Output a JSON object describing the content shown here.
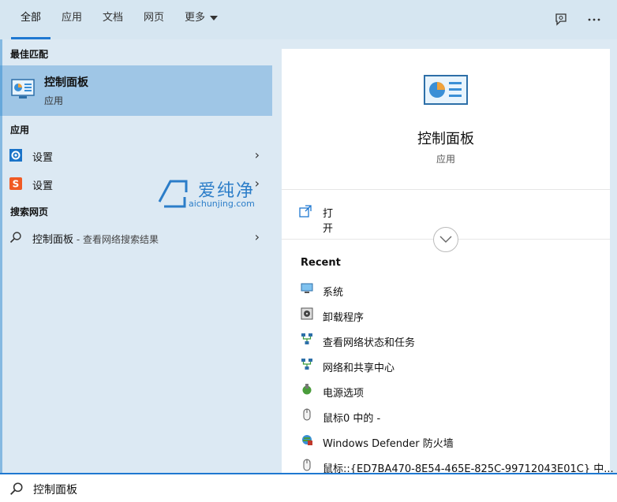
{
  "tabs": [
    {
      "label": "全部",
      "active": true
    },
    {
      "label": "应用",
      "active": false
    },
    {
      "label": "文档",
      "active": false
    },
    {
      "label": "网页",
      "active": false
    },
    {
      "label": "更多",
      "active": false
    }
  ],
  "top_icons": {
    "feedback": "feedback-icon",
    "more": "ellipsis-icon"
  },
  "left": {
    "best_match_header": "最佳匹配",
    "best_match": {
      "title": "控制面板",
      "subtitle": "应用"
    },
    "apps_header": "应用",
    "apps": [
      {
        "label": "设置",
        "icon": "gear-icon"
      },
      {
        "label": "设置",
        "icon": "sogou-icon"
      }
    ],
    "web_header": "搜索网页",
    "web_result": {
      "label": "控制面板",
      "suffix": " - 查看网络搜索结果"
    }
  },
  "right": {
    "title": "控制面板",
    "subtitle": "应用",
    "open_label": "打开",
    "recent_header": "Recent",
    "recent": [
      {
        "label": "系统",
        "icon": "monitor-icon"
      },
      {
        "label": "卸载程序",
        "icon": "uninstall-icon"
      },
      {
        "label": "查看网络状态和任务",
        "icon": "network-icon"
      },
      {
        "label": "网络和共享中心",
        "icon": "network-icon"
      },
      {
        "label": "电源选项",
        "icon": "power-icon"
      },
      {
        "label": "鼠标0 中的 -",
        "icon": "mouse-icon"
      },
      {
        "label": "Windows Defender 防火墙",
        "icon": "firewall-icon"
      },
      {
        "label": "鼠标::{ED7BA470-8E54-465E-825C-99712043E01C} 中...",
        "icon": "mouse-icon"
      }
    ]
  },
  "watermark": {
    "text": "爱纯净",
    "url": "aichunjing.com"
  },
  "search": {
    "value": "控制面板"
  },
  "colors": {
    "accent": "#1f78d1",
    "selected": "#9fc6e6",
    "panel_bg": "#dce9f3"
  }
}
